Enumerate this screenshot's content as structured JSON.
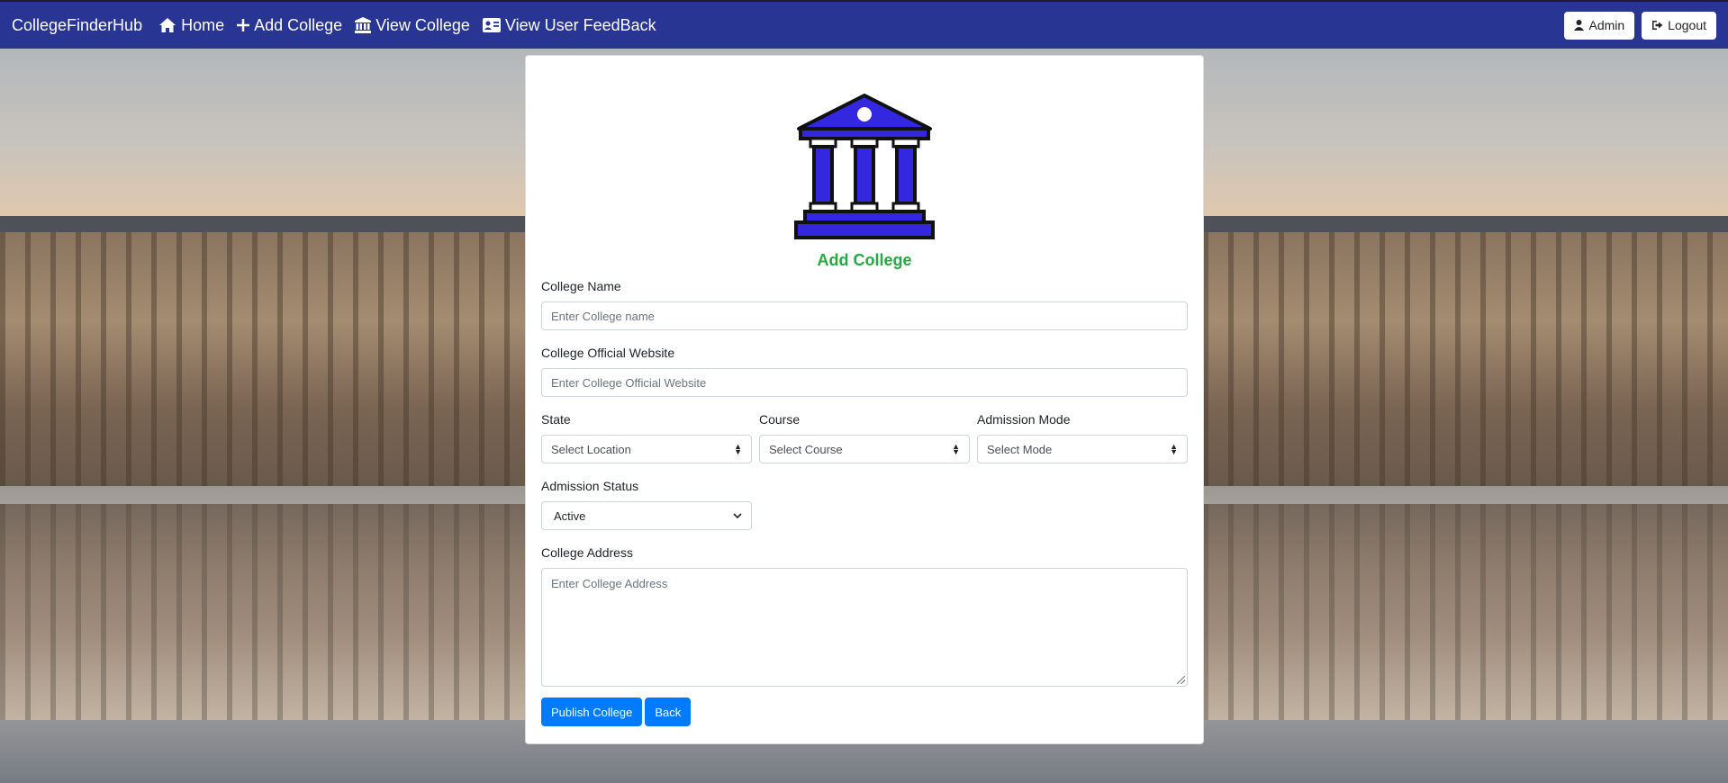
{
  "navbar": {
    "brand": "CollegeFinderHub",
    "items": [
      {
        "label": "Home",
        "icon": "home-icon"
      },
      {
        "label": "Add College",
        "icon": "plus-icon"
      },
      {
        "label": "View College",
        "icon": "institution-icon"
      },
      {
        "label": "View User FeedBack",
        "icon": "id-card-icon"
      }
    ],
    "admin_label": "Admin",
    "logout_label": "Logout"
  },
  "form": {
    "title": "Add College",
    "college_name": {
      "label": "College Name",
      "placeholder": "Enter College name"
    },
    "website": {
      "label": "College Official Website",
      "placeholder": "Enter College Official Website"
    },
    "state": {
      "label": "State",
      "value": "Select Location"
    },
    "course": {
      "label": "Course",
      "value": "Select Course"
    },
    "admission_mode": {
      "label": "Admission Mode",
      "value": "Select Mode"
    },
    "admission_status": {
      "label": "Admission Status",
      "value": "Active"
    },
    "address": {
      "label": "College Address",
      "placeholder": "Enter College Address"
    },
    "publish_label": "Publish College",
    "back_label": "Back"
  },
  "colors": {
    "navbar": "#283593",
    "title": "#28a745",
    "primary": "#007bff",
    "logo_fill": "#3328e0"
  }
}
